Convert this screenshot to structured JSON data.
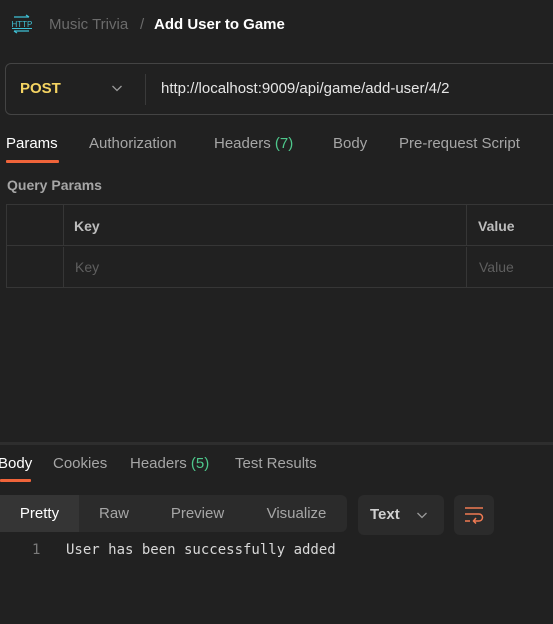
{
  "header": {
    "icon": "http-request-icon",
    "breadcrumb_parent": "Music Trivia",
    "breadcrumb_separator": "/",
    "breadcrumb_current": "Add User to Game"
  },
  "request": {
    "method": "POST",
    "url": "http://localhost:9009/api/game/add-user/4/2",
    "tabs": [
      {
        "label": "Params",
        "active": true
      },
      {
        "label": "Authorization"
      },
      {
        "label": "Headers",
        "count": "(7)"
      },
      {
        "label": "Body"
      },
      {
        "label": "Pre-request Script"
      }
    ],
    "query_params": {
      "title": "Query Params",
      "columns": [
        "Key",
        "Value"
      ],
      "placeholders": {
        "key": "Key",
        "value": "Value"
      }
    }
  },
  "response": {
    "tabs": [
      {
        "label": "Body",
        "active": true
      },
      {
        "label": "Cookies"
      },
      {
        "label": "Headers",
        "count": "(5)"
      },
      {
        "label": "Test Results"
      }
    ],
    "view_modes": [
      {
        "label": "Pretty",
        "active": true
      },
      {
        "label": "Raw"
      },
      {
        "label": "Preview"
      },
      {
        "label": "Visualize"
      }
    ],
    "format": "Text",
    "wrap_icon": "wrap-lines-icon",
    "lines": [
      {
        "number": "1",
        "text": "User has been successfully added"
      }
    ]
  },
  "colors": {
    "background": "#212121",
    "method_post": "#f5d462",
    "accent": "#f0643a",
    "count": "#4ec88c",
    "http_icon": "#3fc1d6"
  }
}
